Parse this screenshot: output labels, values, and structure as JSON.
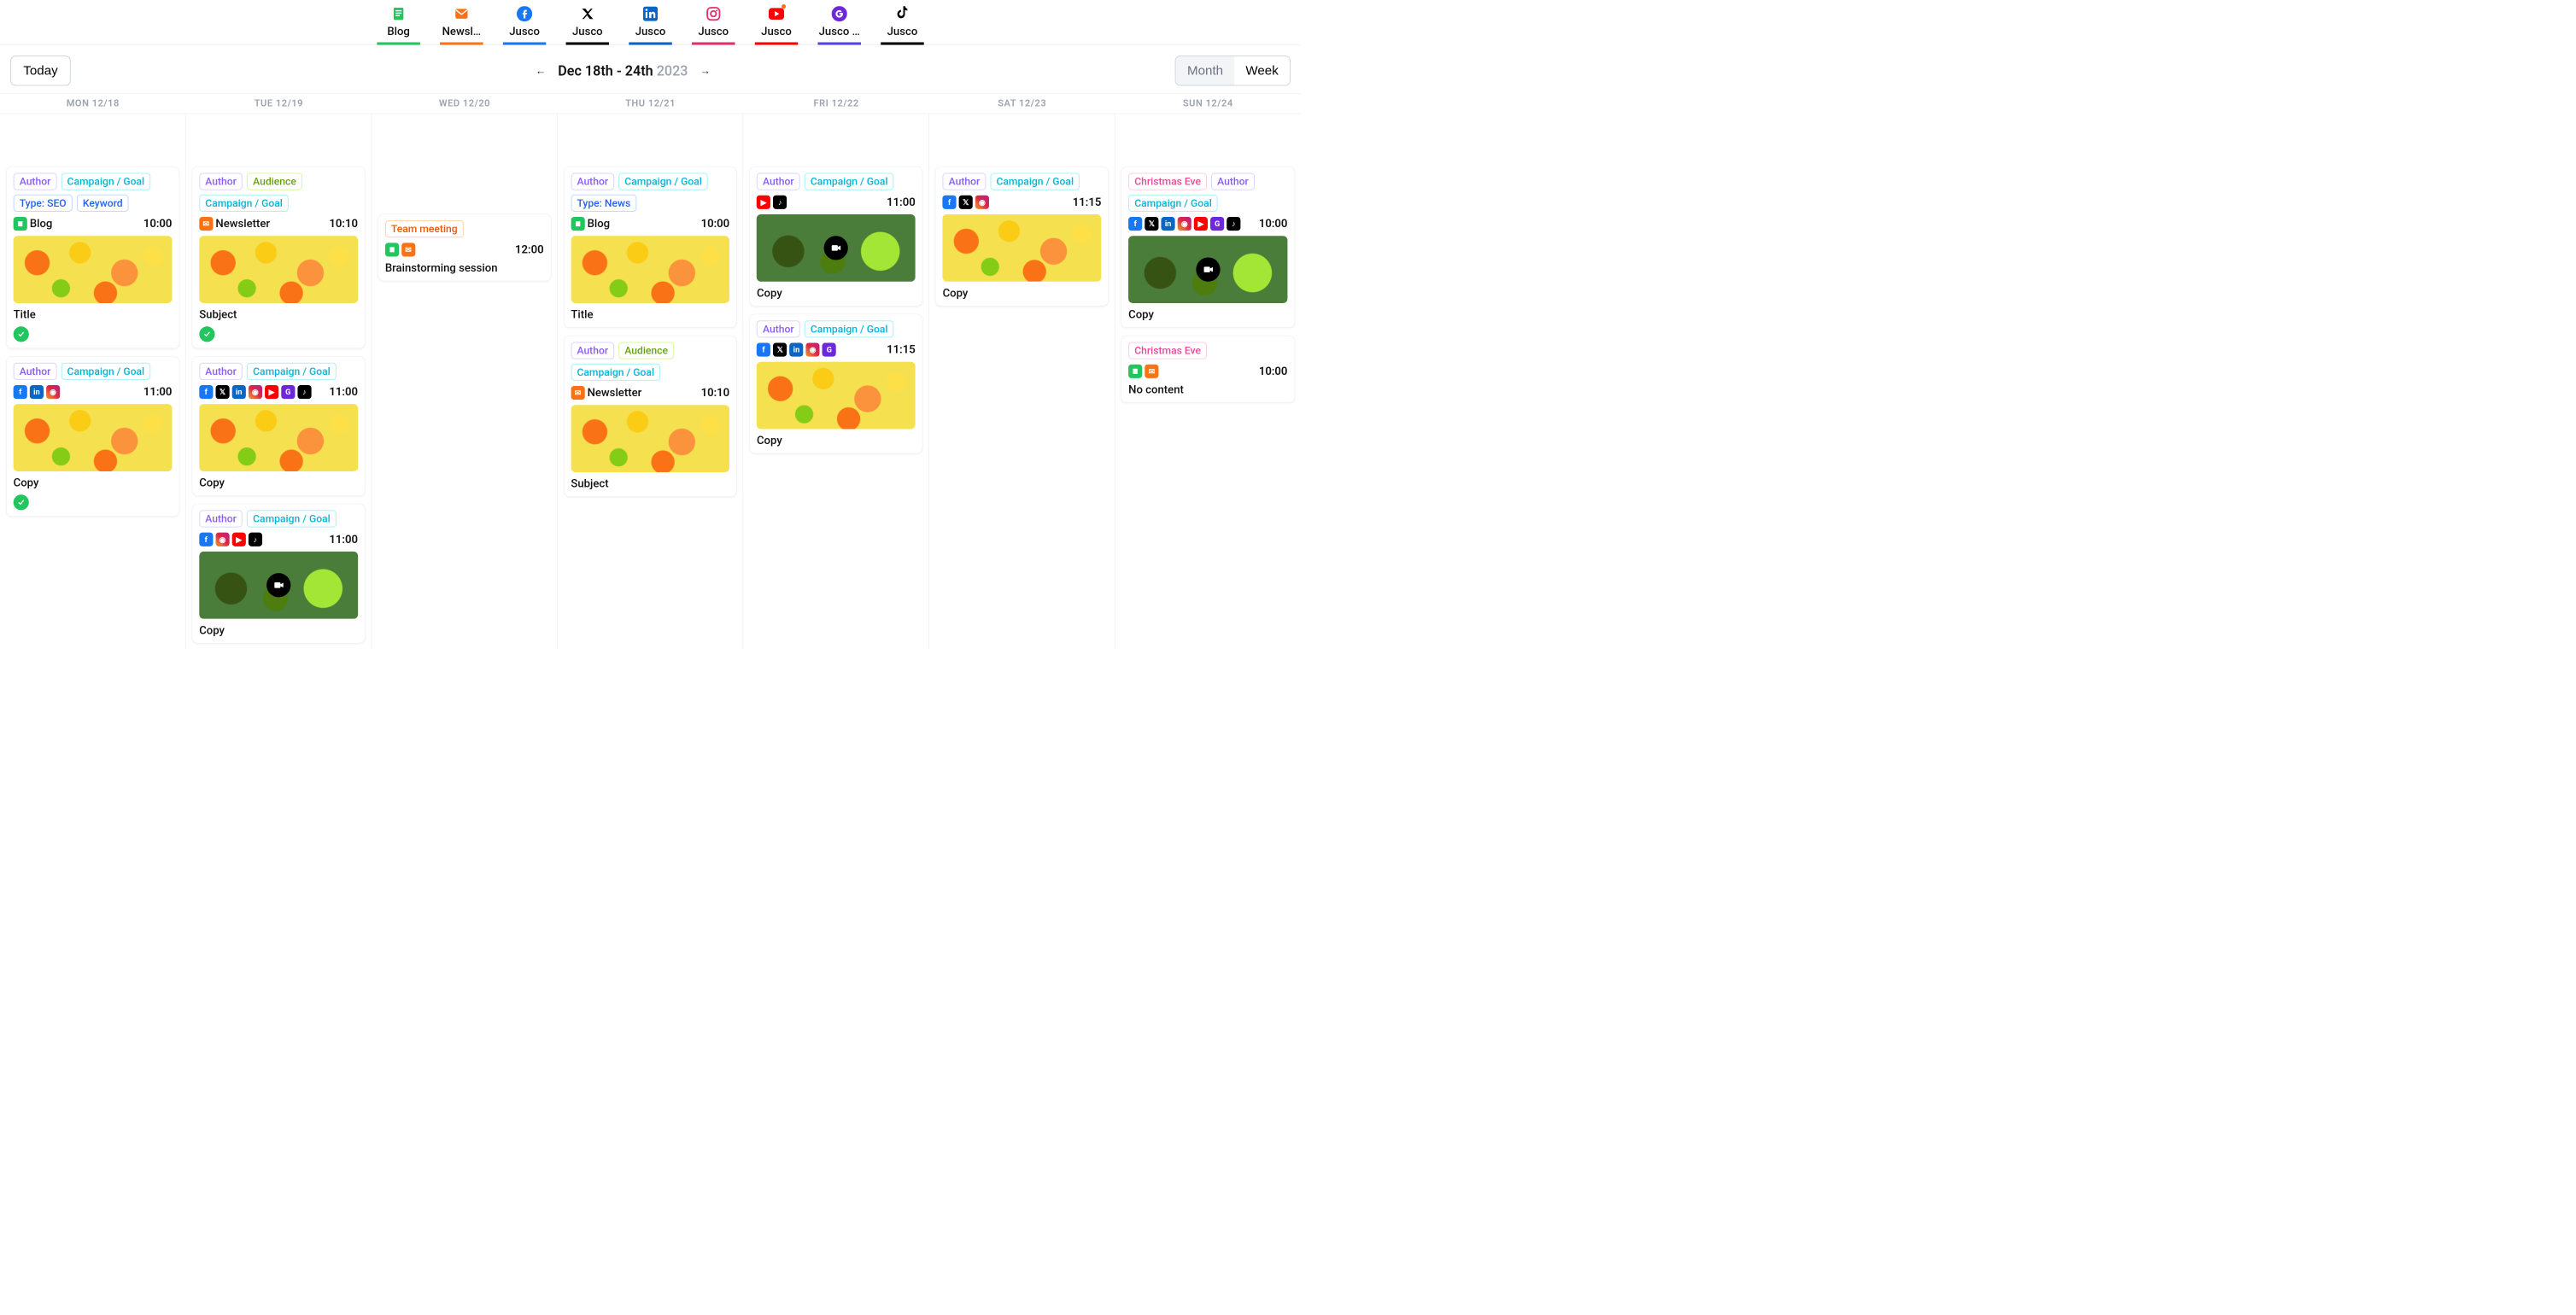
{
  "channels": [
    {
      "label": "Blog",
      "cls": "ch-blog"
    },
    {
      "label": "Newsl…",
      "cls": "ch-news"
    },
    {
      "label": "Jusco",
      "cls": "ch-fb"
    },
    {
      "label": "Jusco",
      "cls": "ch-x"
    },
    {
      "label": "Jusco",
      "cls": "ch-li"
    },
    {
      "label": "Jusco",
      "cls": "ch-ig"
    },
    {
      "label": "Jusco",
      "cls": "ch-yt",
      "notif": true
    },
    {
      "label": "Jusco …",
      "cls": "ch-gb"
    },
    {
      "label": "Jusco",
      "cls": "ch-tk"
    }
  ],
  "toolbar": {
    "today": "Today",
    "range": "Dec 18th - 24th",
    "year": "2023",
    "month": "Month",
    "week": "Week"
  },
  "tags": {
    "author": "Author",
    "campaign": "Campaign / Goal",
    "seo": "Type: SEO",
    "keyword": "Keyword",
    "audience": "Audience",
    "news": "Type: News",
    "christmas": "Christmas Eve",
    "meeting": "Team meeting"
  },
  "labels": {
    "blog": "Blog",
    "newsletter": "Newsletter",
    "title": "Title",
    "subject": "Subject",
    "copy": "Copy",
    "nocontent": "No content",
    "brainstorm": "Brainstorming session"
  },
  "days": [
    {
      "h": "MON 12/18"
    },
    {
      "h": "TUE 12/19"
    },
    {
      "h": "WED 12/20"
    },
    {
      "h": "THU 12/21"
    },
    {
      "h": "FRI 12/22"
    },
    {
      "h": "SAT 12/23"
    },
    {
      "h": "SUN 12/24"
    }
  ],
  "times": {
    "t1000": "10:00",
    "t1010": "10:10",
    "t1100": "11:00",
    "t1115": "11:15",
    "t1200": "12:00"
  }
}
